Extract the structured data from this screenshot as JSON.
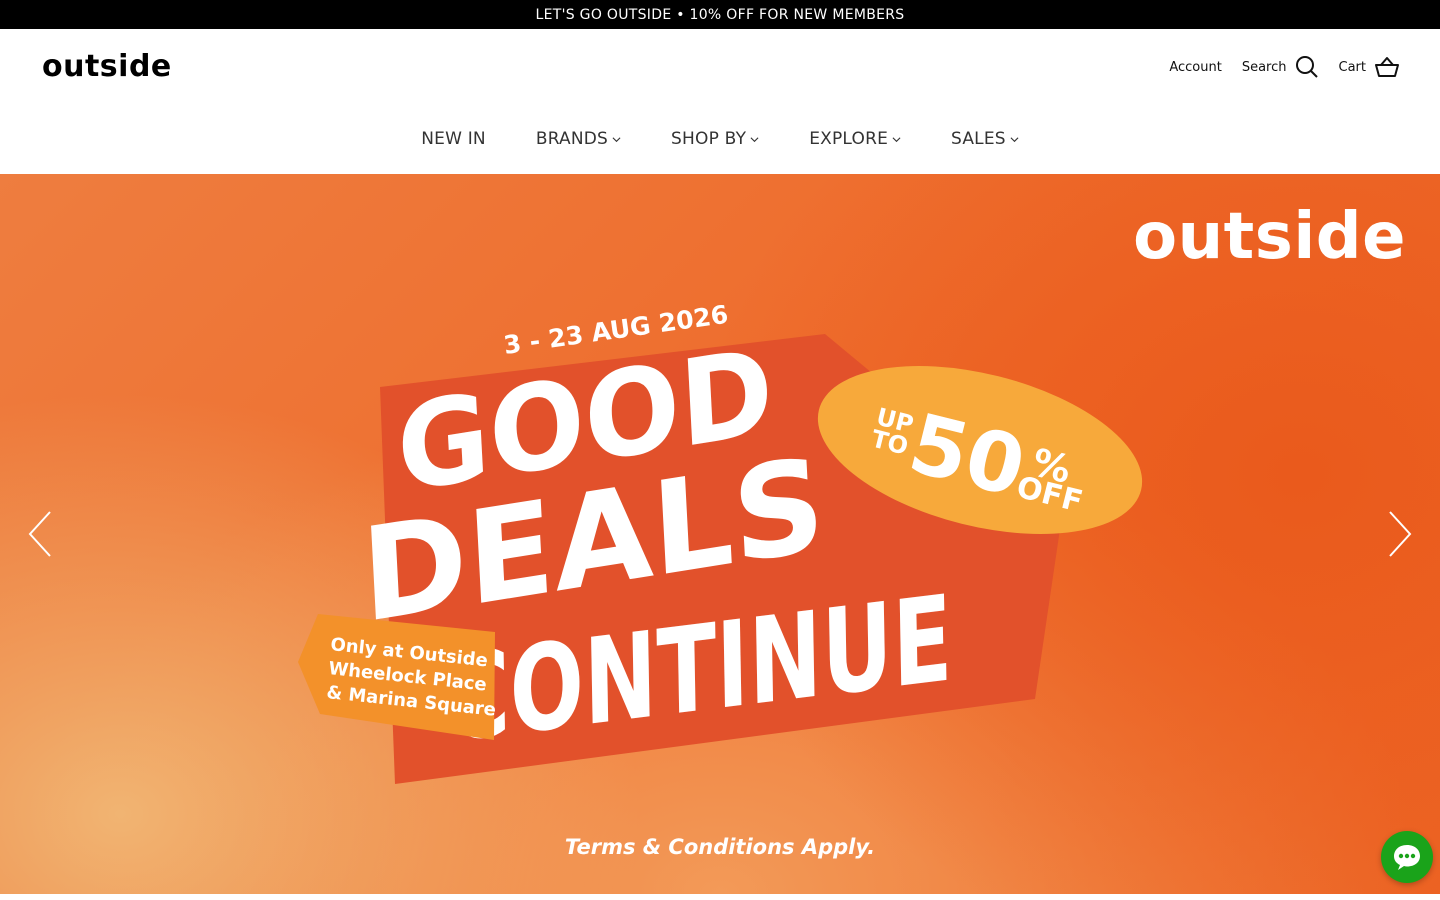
{
  "announcement": "LET'S GO OUTSIDE • 10% OFF FOR NEW MEMBERS",
  "header": {
    "logo": "outside",
    "account_label": "Account",
    "search_label": "Search",
    "cart_label": "Cart"
  },
  "nav": {
    "items": [
      {
        "label": "NEW IN",
        "dropdown": false
      },
      {
        "label": "BRANDS",
        "dropdown": true
      },
      {
        "label": "SHOP BY",
        "dropdown": true
      },
      {
        "label": "EXPLORE",
        "dropdown": true
      },
      {
        "label": "SALES",
        "dropdown": true
      }
    ]
  },
  "hero": {
    "logo": "outside",
    "date": "3 - 23 AUG 2026",
    "headline_1": "GOOD",
    "headline_2": "DEALS",
    "headline_3": "CONTINUE",
    "badge_up": "UP",
    "badge_to": "TO",
    "badge_number": "50",
    "badge_percent": "%",
    "badge_off": "OFF",
    "tag_line_1": "Only at Outside",
    "tag_line_2": "Wheelock Place",
    "tag_line_3": "& Marina Square",
    "terms": "Terms & Conditions Apply."
  },
  "colors": {
    "announcement_bg": "#000000",
    "hero_orange": "#ee6a2a",
    "panel_red": "#e2512b",
    "badge_yellow": "#f7a93b",
    "tag_orange": "#f3912a",
    "chat_green": "#1aa31a"
  },
  "icons": {
    "search": "search-icon",
    "cart": "basket-icon",
    "prev": "chevron-left-icon",
    "next": "chevron-right-icon",
    "chat": "chat-bubble-icon"
  }
}
